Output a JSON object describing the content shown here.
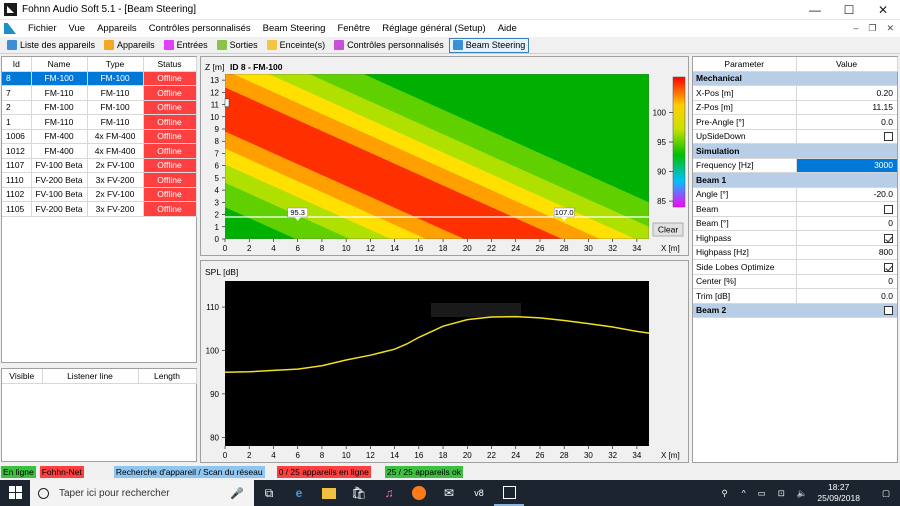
{
  "window": {
    "title": "Fohnn Audio Soft 5.1 - [Beam Steering]",
    "minimize": "—",
    "maximize": "☐",
    "close": "✕"
  },
  "menu": [
    "Fichier",
    "Vue",
    "Appareils",
    "Contrôles personnalisés",
    "Beam Steering",
    "Fenêtre",
    "Réglage général (Setup)",
    "Aide"
  ],
  "mdi": {
    "minimize": "–",
    "restore": "❐",
    "close": "✕"
  },
  "toolbar": [
    {
      "label": "Liste des appareils",
      "color": "#3a8fd6"
    },
    {
      "label": "Appareils",
      "color": "#f5a623"
    },
    {
      "label": "Entrées",
      "color": "#e040fb"
    },
    {
      "label": "Sorties",
      "color": "#8bc34a"
    },
    {
      "label": "Enceinte(s)",
      "color": "#f5c542"
    },
    {
      "label": "Contrôles personnalisés",
      "color": "#c94fd8"
    },
    {
      "label": "Beam Steering",
      "color": "#3a8fd6"
    }
  ],
  "devices": {
    "columns": [
      "Id",
      "Name",
      "Type",
      "Status"
    ],
    "rows": [
      [
        "8",
        "FM-100",
        "FM-100",
        "Offline"
      ],
      [
        "7",
        "FM-110",
        "FM-110",
        "Offline"
      ],
      [
        "2",
        "FM-100",
        "FM-100",
        "Offline"
      ],
      [
        "1",
        "FM-110",
        "FM-110",
        "Offline"
      ],
      [
        "1006",
        "FM-400",
        "4x FM-400",
        "Offline"
      ],
      [
        "1012",
        "FM-400",
        "4x FM-400",
        "Offline"
      ],
      [
        "1107",
        "FV-100 Beta",
        "2x FV-100",
        "Offline"
      ],
      [
        "1110",
        "FV-200 Beta",
        "3x FV-200",
        "Offline"
      ],
      [
        "1102",
        "FV-100 Beta",
        "2x FV-100",
        "Offline"
      ],
      [
        "1105",
        "FV-200 Beta",
        "3x FV-200",
        "Offline"
      ]
    ]
  },
  "listener": {
    "columns": [
      "Visible",
      "Listener line",
      "Length"
    ]
  },
  "heatmap": {
    "title": "ID 8 - FM-100",
    "zlabel": "Z [m]",
    "xlabel": "X [m]",
    "clear_button": "Clear",
    "marker1": "95.3",
    "marker2": "107.0"
  },
  "spl": {
    "ylabel": "SPL [dB]",
    "xlabel": "X [m]"
  },
  "chart_data": [
    {
      "type": "heatmap",
      "title": "ID 8 - FM-100",
      "xlabel": "X [m]",
      "ylabel": "Z [m]",
      "xlim": [
        0,
        35
      ],
      "ylim": [
        0,
        13.5
      ],
      "xticks": [
        0,
        2,
        4,
        6,
        8,
        10,
        12,
        14,
        16,
        18,
        20,
        22,
        24,
        26,
        28,
        30,
        32,
        34
      ],
      "yticks": [
        0,
        1,
        2,
        3,
        4,
        5,
        6,
        7,
        8,
        9,
        10,
        11,
        12,
        13
      ],
      "colorbar": {
        "range": [
          84,
          106
        ],
        "ticks": [
          85,
          90,
          95,
          100
        ]
      },
      "listener_line_z": 1.8,
      "annotations": [
        {
          "x": 6,
          "z": 1.8,
          "text": "95.3"
        },
        {
          "x": 28,
          "z": 1.8,
          "text": "107.0"
        }
      ]
    },
    {
      "type": "line",
      "xlabel": "X [m]",
      "ylabel": "SPL [dB]",
      "xlim": [
        0,
        35
      ],
      "ylim": [
        78,
        116
      ],
      "xticks": [
        0,
        2,
        4,
        6,
        8,
        10,
        12,
        14,
        16,
        18,
        20,
        22,
        24,
        26,
        28,
        30,
        32,
        34
      ],
      "yticks": [
        80,
        90,
        100,
        110
      ],
      "series": [
        {
          "x": [
            0,
            2,
            4,
            6,
            8,
            10,
            12,
            14,
            15,
            16,
            18,
            20,
            22,
            24,
            26,
            28,
            30,
            32,
            34,
            35
          ],
          "y": [
            95.0,
            95.1,
            95.4,
            95.7,
            96.5,
            97.8,
            98.9,
            100.3,
            101.5,
            103.0,
            105.6,
            107.1,
            107.7,
            107.8,
            107.5,
            106.9,
            106.2,
            105.4,
            104.4,
            104.0
          ]
        }
      ]
    }
  ],
  "params": {
    "columns": [
      "Parameter",
      "Value"
    ],
    "rows": [
      {
        "section": "Mechanical"
      },
      {
        "name": "X-Pos [m]",
        "value": "0.20"
      },
      {
        "name": "Z-Pos [m]",
        "value": "11.15"
      },
      {
        "name": "Pre-Angle [°]",
        "value": "0.0"
      },
      {
        "name": "UpSideDown",
        "check": false
      },
      {
        "section": "Simulation"
      },
      {
        "name": "Frequency [Hz]",
        "value": "3000",
        "highlight": true
      },
      {
        "section": "Beam 1"
      },
      {
        "name": "Angle [°]",
        "value": "-20.0"
      },
      {
        "name": "Beam",
        "check": false
      },
      {
        "name": "Beam [°]",
        "value": "0"
      },
      {
        "name": "Highpass",
        "check": true
      },
      {
        "name": "Highpass [Hz]",
        "value": "800"
      },
      {
        "name": "Side Lobes Optimize",
        "check": true
      },
      {
        "name": "Center [%]",
        "value": "0"
      },
      {
        "name": "Trim [dB]",
        "value": "0.0"
      },
      {
        "section": "Beam 2",
        "check": false
      }
    ]
  },
  "statusbar": [
    {
      "label": "En ligne",
      "bg": "#3cc040"
    },
    {
      "label": "Fohhn-Net",
      "bg": "#ff4040"
    },
    {
      "label": "Recherche d'appareil / Scan du réseau",
      "bg": "#8ec6f0"
    },
    {
      "label": "0 / 25 appareils en ligne",
      "bg": "#ff4040"
    },
    {
      "label": "25 / 25 appareils ok",
      "bg": "#3cc040"
    }
  ],
  "taskbar": {
    "search_placeholder": "Taper ici pour rechercher",
    "time": "18:27",
    "date": "25/09/2018"
  }
}
